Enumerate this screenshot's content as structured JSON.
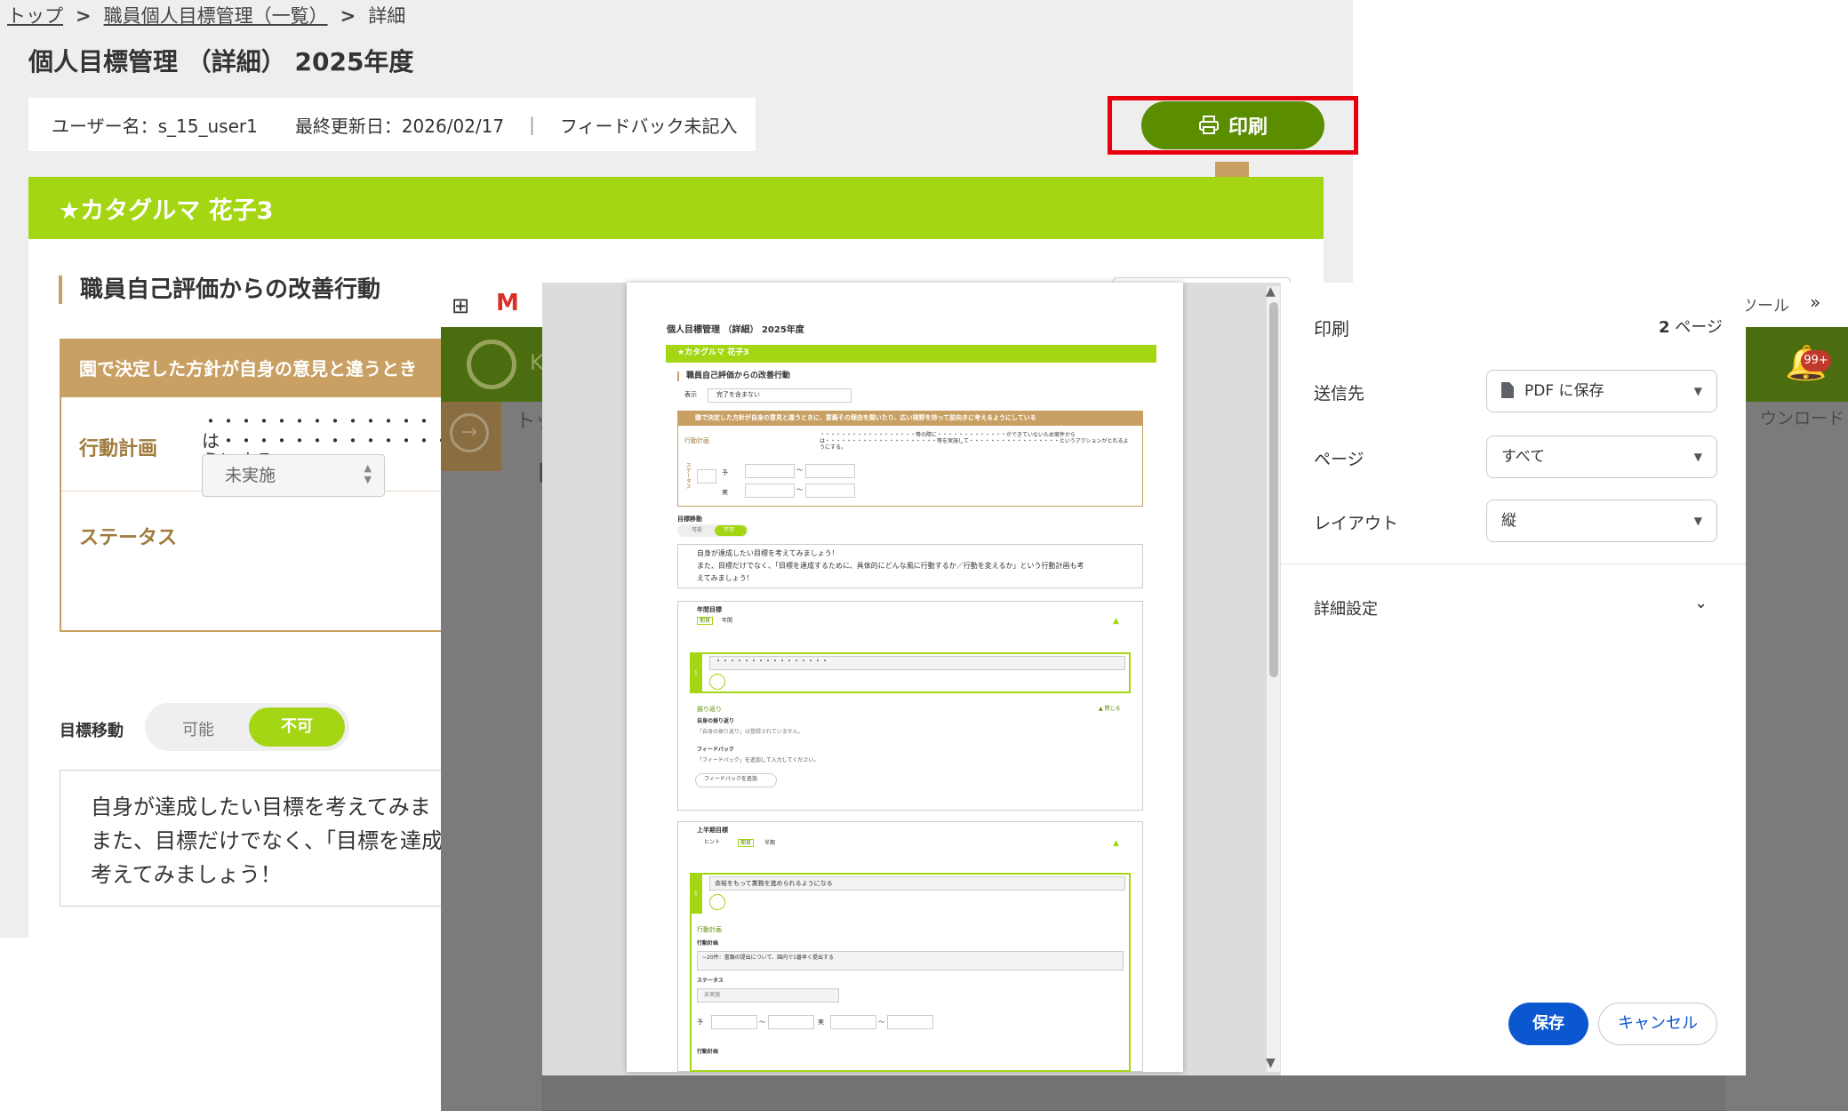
{
  "breadcrumb": {
    "top": "トップ",
    "list": "職員個人目標管理（一覧）",
    "current": "詳細",
    "sep": ">"
  },
  "page": {
    "title": "個人目標管理 （詳細） 2025年度",
    "user": "ユーザー名：s_15_user1",
    "updated": "最終更新日：2026/02/17",
    "feedback": "フィードバック未記入",
    "print_label": "印刷",
    "staff_name": "★カタグルマ 花子3"
  },
  "section": {
    "title": "職員自己評価からの改善行動",
    "policy_header": "園で決定した方針が自身の意見と違うとき",
    "plan_label": "行動計画",
    "plan_text_1": "・・・・・・・・・・・・・",
    "plan_text_2": "は・・・・・・・・・・・・・",
    "plan_text_3": "うにする。",
    "status_label": "ステータス",
    "status_value": "未実施"
  },
  "goal_move": {
    "label": "目標移動",
    "opt_yes": "可能",
    "opt_no": "不可"
  },
  "hint": {
    "line1": "自身が達成したい目標を考えてみま",
    "line2": "また、目標だけでなく、「目標を達成",
    "line3": "考えてみましょう！"
  },
  "browser": {
    "gmail": "M",
    "tools": "ツール",
    "more": "»",
    "logo_text": "K",
    "badge": "99+",
    "download": "ウンロード",
    "dim_crumb": "トッ",
    "dim_title": "目"
  },
  "print_dialog": {
    "title": "印刷",
    "pages_count": "2",
    "pages_unit": "ページ",
    "dest_label": "送信先",
    "dest_value": "PDF に保存",
    "page_label": "ページ",
    "page_value": "すべて",
    "layout_label": "レイアウト",
    "layout_value": "縦",
    "advanced": "詳細設定",
    "save": "保存",
    "cancel": "キャンセル"
  },
  "preview": {
    "title": "個人目標管理 （詳細） 2025年度",
    "staff": "★カタグルマ 花子3",
    "section": "職員自己評価からの改善行動",
    "display_label": "表示",
    "display_value": "完了を含まない",
    "policy": "園で決定した方針が自身の意見と違うときに、意義その理由を聞いたり、広い視野を持って前向きに考えるようにしている",
    "plan_label": "行動計画",
    "plan_text": "・・・・・・・・・・・・・・・・・・等の際に・・・・・・・・・・・・・ができていないため案件から",
    "plan_text2": "は・・・・・・・・・・・・・・・・・・・・・等を実施して・・・・・・・・・・・・・・・・・というアクションがとれるよ",
    "plan_text3": "うにする。",
    "status_v": "ステータス",
    "yo": "予",
    "ji": "実",
    "tilde": "～",
    "goal_move": "目標移動",
    "opt_yes": "可能",
    "opt_no": "不可",
    "hint1": "自身が達成したい目標を考えてみましょう！",
    "hint2": "また、目標だけでなく、「目標を達成するために、具体的にどんな風に行動するか／行動を変えるか」という行動計画も考",
    "hint3": "えてみましょう！",
    "annual": "年間目標",
    "tag": "期首",
    "annual_sub": "年間",
    "dots": "・・・・・・・・・・・・・・・・",
    "num1": "1",
    "reflect": "振り返り",
    "close": "▲ 閉じる",
    "self_reflect": "自身の振り返り",
    "self_reflect_note": "「自身の振り返り」は登録されていません。",
    "fb": "フィードバック",
    "fb_note": "「フィードバック」を追加して入力してください。",
    "fb_add": "フィードバックを追加",
    "first_half": "上半期目標",
    "hint_tag": "ヒント",
    "half": "半期",
    "goal2": "余裕をもって業務を進められるようになる",
    "action_plan": "行動計画",
    "plan_label2": "行動計画",
    "plan2_text": "~20件：書類の提出について、園内で1番早く提出する",
    "status_label2": "ステータス",
    "status_value2": "未実施",
    "plan_label3": "行動計画"
  }
}
